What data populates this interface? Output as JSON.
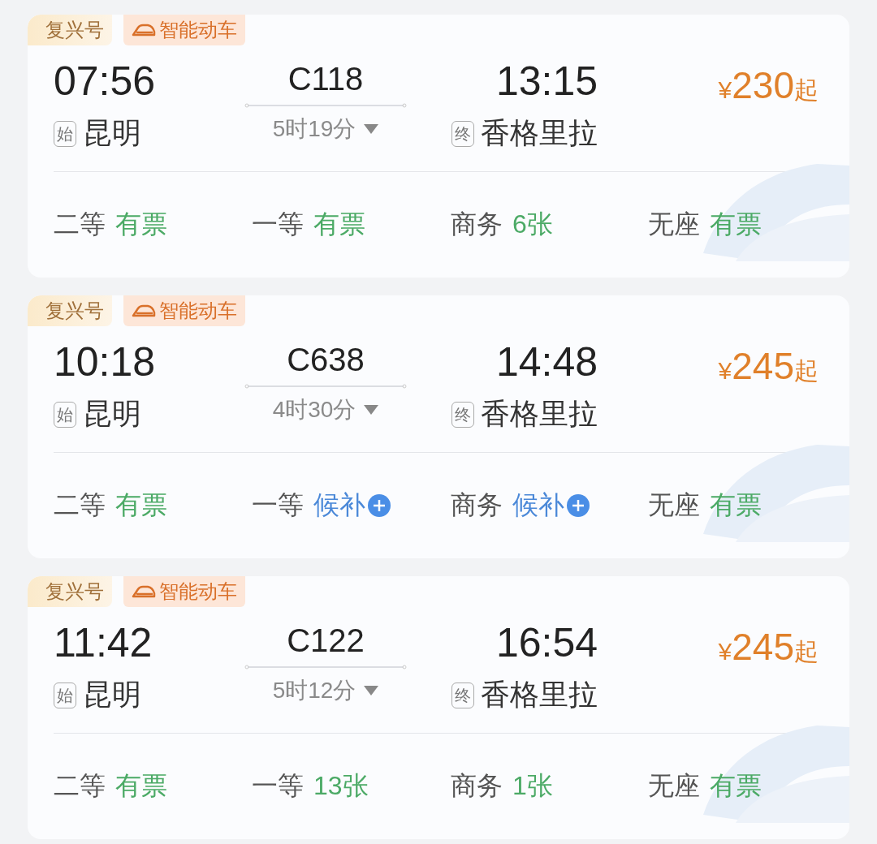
{
  "trains": [
    {
      "tags": [
        {
          "kind": "brand",
          "label": "复兴号"
        },
        {
          "kind": "smart",
          "label": "智能动车"
        }
      ],
      "depart_time": "07:56",
      "train_no": "C118",
      "arrive_time": "13:15",
      "from_badge": "始",
      "from": "昆明",
      "duration": "5时19分",
      "to_badge": "终",
      "to": "香格里拉",
      "price": {
        "currency": "¥",
        "amount": "230",
        "suffix": "起"
      },
      "seats": [
        {
          "class": "二等",
          "status": "有票",
          "kind": "available"
        },
        {
          "class": "一等",
          "status": "有票",
          "kind": "available"
        },
        {
          "class": "商务",
          "status": "6张",
          "kind": "available"
        },
        {
          "class": "无座",
          "status": "有票",
          "kind": "available"
        }
      ]
    },
    {
      "tags": [
        {
          "kind": "brand",
          "label": "复兴号"
        },
        {
          "kind": "smart",
          "label": "智能动车"
        }
      ],
      "depart_time": "10:18",
      "train_no": "C638",
      "arrive_time": "14:48",
      "from_badge": "始",
      "from": "昆明",
      "duration": "4时30分",
      "to_badge": "终",
      "to": "香格里拉",
      "price": {
        "currency": "¥",
        "amount": "245",
        "suffix": "起"
      },
      "seats": [
        {
          "class": "二等",
          "status": "有票",
          "kind": "available"
        },
        {
          "class": "一等",
          "status": "候补",
          "kind": "waitlist"
        },
        {
          "class": "商务",
          "status": "候补",
          "kind": "waitlist"
        },
        {
          "class": "无座",
          "status": "有票",
          "kind": "available"
        }
      ]
    },
    {
      "tags": [
        {
          "kind": "brand",
          "label": "复兴号"
        },
        {
          "kind": "smart",
          "label": "智能动车"
        }
      ],
      "depart_time": "11:42",
      "train_no": "C122",
      "arrive_time": "16:54",
      "from_badge": "始",
      "from": "昆明",
      "duration": "5时12分",
      "to_badge": "终",
      "to": "香格里拉",
      "price": {
        "currency": "¥",
        "amount": "245",
        "suffix": "起"
      },
      "seats": [
        {
          "class": "二等",
          "status": "有票",
          "kind": "available"
        },
        {
          "class": "一等",
          "status": "13张",
          "kind": "available"
        },
        {
          "class": "商务",
          "status": "1张",
          "kind": "available"
        },
        {
          "class": "无座",
          "status": "有票",
          "kind": "available"
        }
      ]
    }
  ]
}
